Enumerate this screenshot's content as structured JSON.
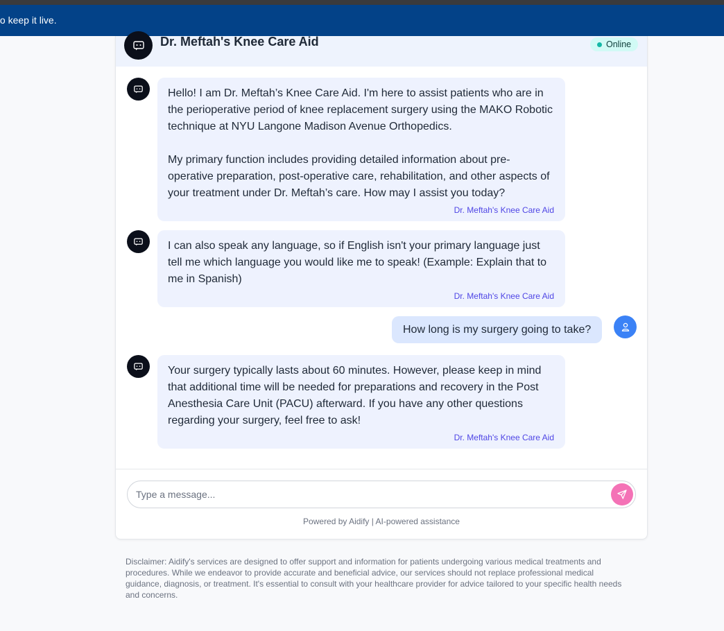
{
  "banner": {
    "text": "to keep it live."
  },
  "header": {
    "title": "Dr. Meftah's Knee Care Aid",
    "status": "Online",
    "avatar_icon": "chat-bot-icon"
  },
  "messages": [
    {
      "role": "bot",
      "text": "Hello! I am Dr. Meftah’s Knee Care Aid. I'm here to assist patients who are in the perioperative period of knee replacement surgery using the MAKO Robotic technique at NYU Langone Madison Avenue Orthopedics.\n\nMy primary function includes providing detailed information about pre-operative preparation, post-operative care, rehabilitation, and other aspects of your treatment under Dr. Meftah’s care. How may I assist you today?",
      "sender": "Dr. Meftah's Knee Care Aid"
    },
    {
      "role": "bot",
      "text": "I can also speak any language, so if English isn't your primary language just tell me which language you would like me to speak! (Example: Explain that to me in Spanish)",
      "sender": "Dr. Meftah's Knee Care Aid"
    },
    {
      "role": "user",
      "text": "How long is my surgery going to take?"
    },
    {
      "role": "bot",
      "text": "Your surgery typically lasts about 60 minutes. However, please keep in mind that additional time will be needed for preparations and recovery in the Post Anesthesia Care Unit (PACU) afterward. If you have any other questions regarding your surgery, feel free to ask!",
      "sender": "Dr. Meftah's Knee Care Aid"
    }
  ],
  "composer": {
    "placeholder": "Type a message...",
    "value": "",
    "send_icon": "send-icon"
  },
  "footer": {
    "powered_by": "Powered by Aidify | AI-powered assistance"
  },
  "disclaimer": "Disclaimer: Aidify's services are designed to offer support and information for patients undergoing various medical treatments and procedures. While we endeavor to provide accurate and beneficial advice, our services should not replace professional medical guidance, diagnosis, or treatment. It's essential to consult with your healthcare provider for advice tailored to your specific health needs and concerns.",
  "colors": {
    "banner": "#034288",
    "bot_bubble": "#eef2fe",
    "user_bubble": "#dbe7fe",
    "sender_label": "#4f46e5",
    "send_button": "#f472b6",
    "online_dot": "#14b8a6"
  }
}
